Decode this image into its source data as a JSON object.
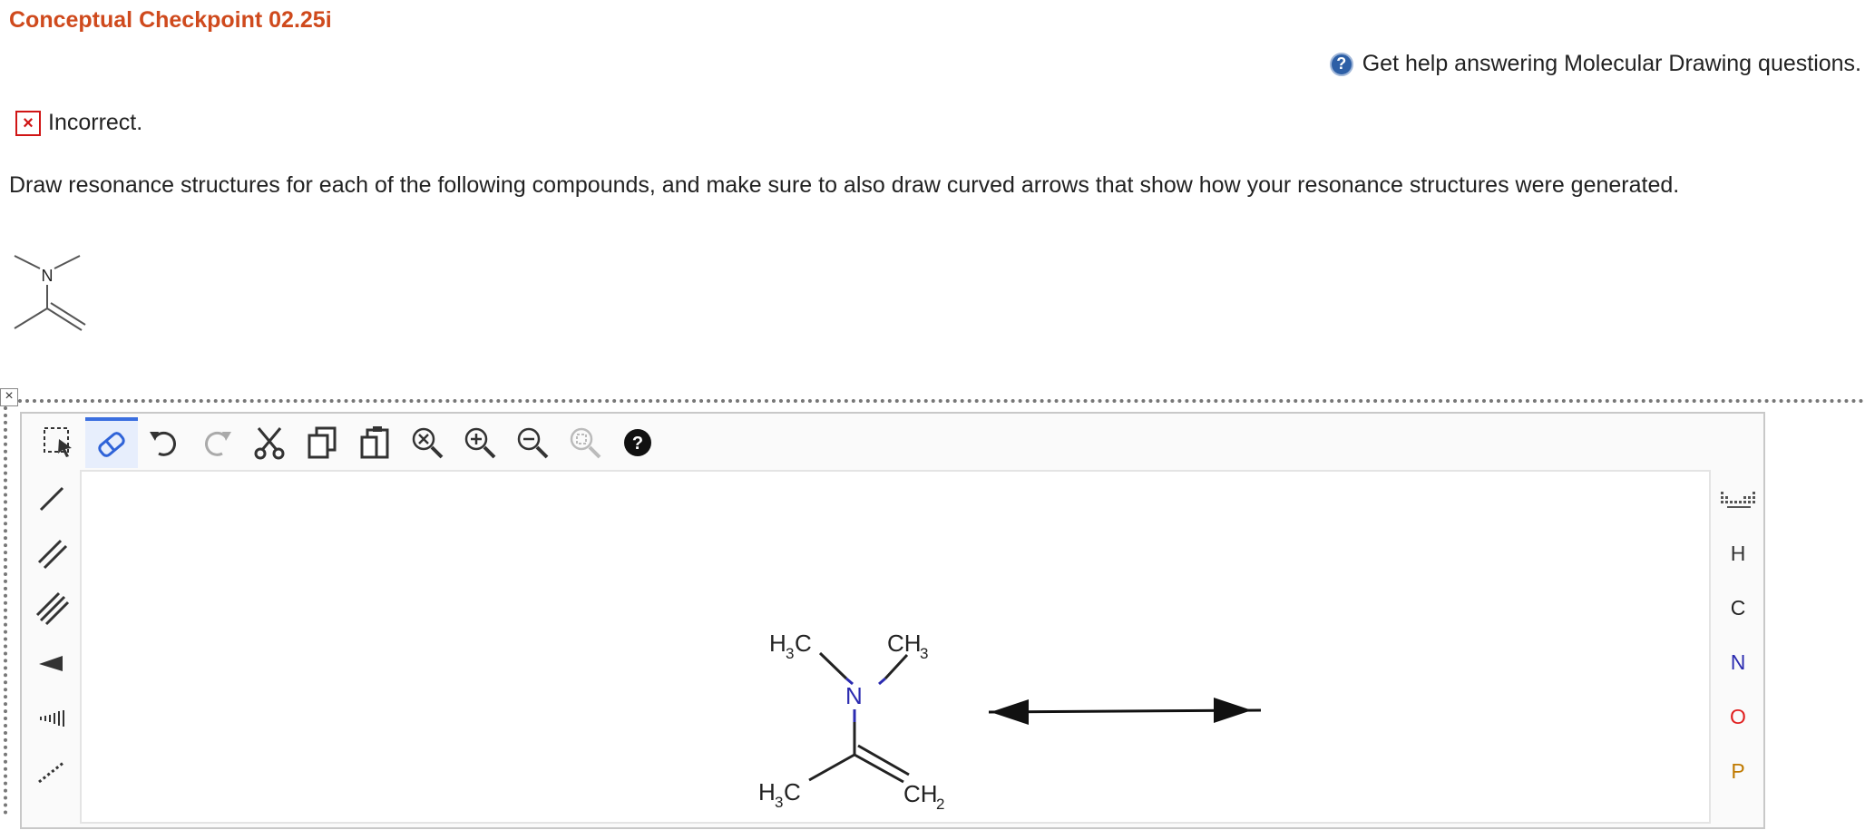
{
  "title": "Conceptual Checkpoint 02.25i",
  "help": {
    "icon": "help-circle-icon",
    "icon_glyph": "?",
    "text": "Get help answering Molecular Drawing questions."
  },
  "status": {
    "icon_glyph": "×",
    "text": "Incorrect."
  },
  "question": "Draw resonance structures for each of the following compounds, and make sure to also draw curved arrows that show how your resonance structures were generated.",
  "thumbnail": {
    "atom": "N"
  },
  "editor": {
    "close_glyph": "×",
    "toolbar": {
      "items": [
        "select-tool",
        "eraser-tool",
        "undo",
        "redo",
        "cut",
        "copy",
        "paste",
        "zoom-reset",
        "zoom-in",
        "zoom-out",
        "zoom-fit",
        "help"
      ],
      "help_glyph": "?"
    },
    "left_tools": [
      "single-bond",
      "double-bond",
      "triple-bond",
      "wedge-bond",
      "hash-bond",
      "dashed-bond"
    ],
    "elements": [
      {
        "symbol": "H",
        "color": "#333333"
      },
      {
        "symbol": "C",
        "color": "#222222"
      },
      {
        "symbol": "N",
        "color": "#2b2bb0"
      },
      {
        "symbol": "O",
        "color": "#e02020"
      },
      {
        "symbol": "P",
        "color": "#c07a00"
      }
    ],
    "molecule": {
      "labels": {
        "h3c_top_sub": "3",
        "h3c_top_main": "H",
        "h3c_top_c": "C",
        "ch3_c": "CH",
        "ch3_sub": "3",
        "n": "N",
        "h3c_bottom_main": "H",
        "h3c_bottom_sub": "3",
        "h3c_bottom_c": "C",
        "ch2_c": "CH",
        "ch2_sub": "2"
      }
    }
  },
  "colors": {
    "title": "#cf4a1d",
    "incorrect": "#d01515",
    "nitrogen": "#2b2bb0",
    "active_tool": "#3b6fe0"
  }
}
